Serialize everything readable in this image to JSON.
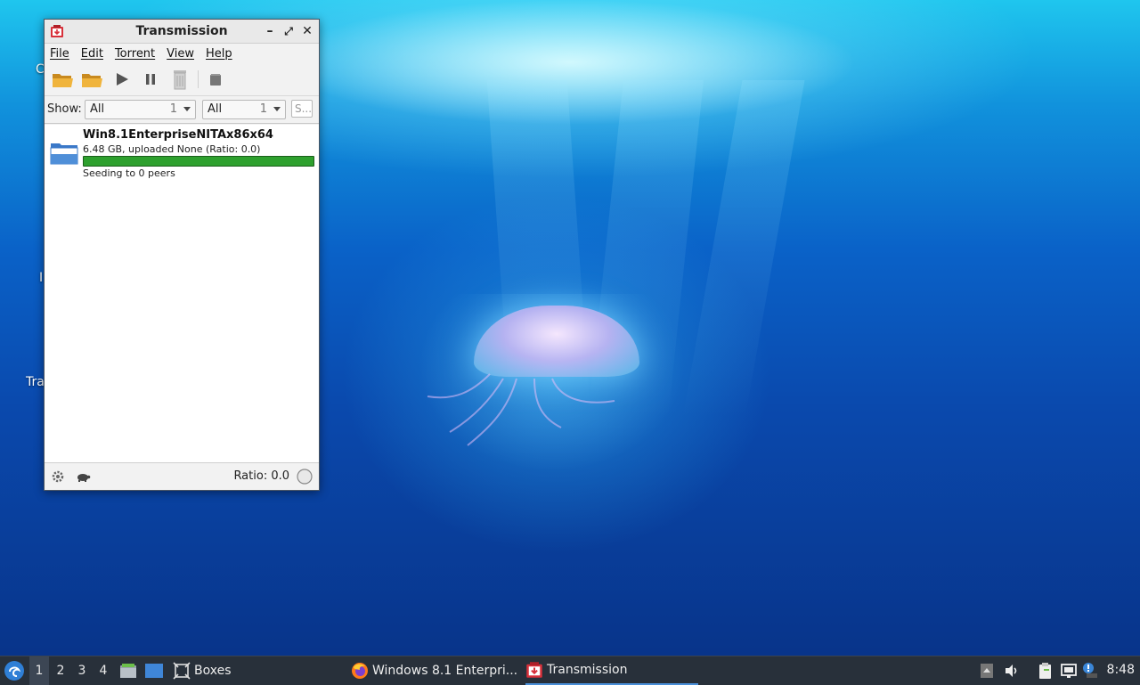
{
  "desktop": {
    "icon_labels": [
      "C",
      "I",
      "Tra"
    ]
  },
  "window": {
    "title": "Transmission",
    "controls": {
      "minimize": "–",
      "maximize": "⤢",
      "close": "✕"
    },
    "menu": [
      "File",
      "Edit",
      "Torrent",
      "View",
      "Help"
    ],
    "toolbar": {
      "buttons": [
        "open-torrent",
        "open-folder",
        "start",
        "pause",
        "remove",
        "properties"
      ]
    },
    "filter": {
      "show_label": "Show:",
      "activity": {
        "value": "All",
        "count": "1"
      },
      "tracker": {
        "value": "All",
        "count": "1"
      },
      "search_placeholder": "S..."
    },
    "torrent": {
      "name": "Win8.1EnterpriseNITAx86x64",
      "progress_text": "6.48 GB, uploaded None (Ratio: 0.0)",
      "progress": 1.0,
      "progress_color": "#2ea02e",
      "status": "Seeding to 0 peers"
    },
    "statusbar": {
      "ratio": "Ratio: 0.0"
    }
  },
  "taskbar": {
    "workspaces": [
      "1",
      "2",
      "3",
      "4"
    ],
    "active_workspace": "1",
    "tasks": [
      {
        "label": "Boxes",
        "icon": "boxes-icon"
      },
      {
        "label": "Windows 8.1 Enterpri...",
        "icon": "firefox-icon"
      },
      {
        "label": "Transmission",
        "icon": "transmission-icon"
      }
    ],
    "clock": "8:48"
  }
}
